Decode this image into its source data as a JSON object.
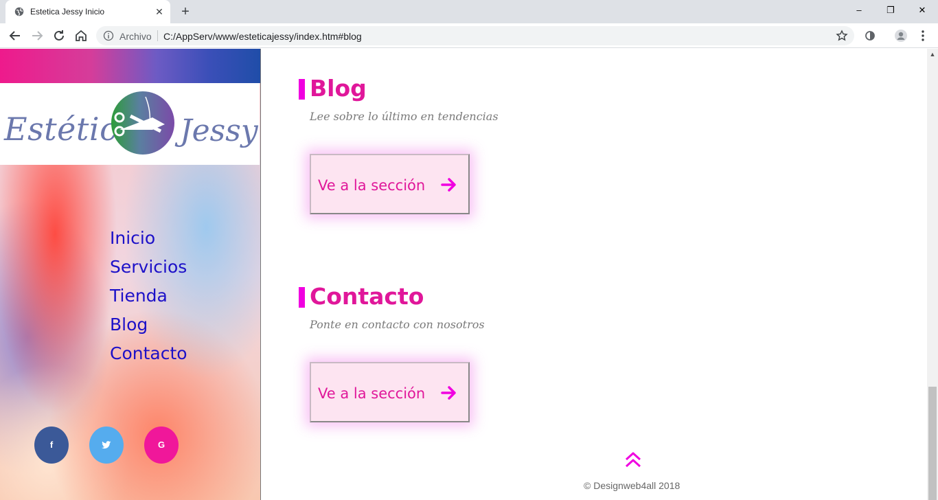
{
  "browser": {
    "tab_title": "Estetica Jessy Inicio",
    "tab_close": "✕",
    "new_tab": "+",
    "window_controls": {
      "minimize": "–",
      "restore": "❐",
      "close": "✕"
    },
    "address": {
      "scheme_label": "Archivo",
      "url": "C:/AppServ/www/esteticajessy/index.htm#blog"
    }
  },
  "sidebar": {
    "logo": {
      "left": "Estética",
      "right": "Jessy"
    },
    "nav": [
      "Inicio",
      "Servicios",
      "Tienda",
      "Blog",
      "Contacto"
    ],
    "social": [
      {
        "label": "f",
        "color": "#3b5998"
      },
      {
        "label": "t",
        "color": "#55acee"
      },
      {
        "label": "G",
        "color": "#f0179a"
      }
    ]
  },
  "sections": [
    {
      "title": "Blog",
      "subtitle": "Lee sobre lo último en tendencias",
      "cta": "Ve a la sección"
    },
    {
      "title": "Contacto",
      "subtitle": "Ponte en contacto con nosotros",
      "cta": "Ve a la sección"
    }
  ],
  "footer": {
    "copyright": "© Designweb4all 2018"
  },
  "colors": {
    "accent": "#e0179a",
    "bar": "#f000e0",
    "nav_link": "#1c10c8"
  }
}
